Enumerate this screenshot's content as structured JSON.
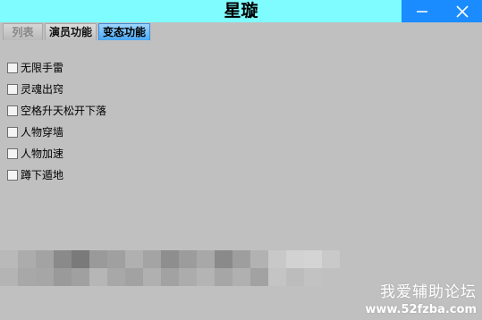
{
  "window": {
    "title": "星璇",
    "minimize_icon": "minimize-icon",
    "close_icon": "close-icon",
    "titlebar_color": "#7ffcff",
    "button_color": "#1a8cff"
  },
  "tabs": [
    {
      "label": "列表",
      "state": "disabled"
    },
    {
      "label": "演员功能",
      "state": "normal"
    },
    {
      "label": "变态功能",
      "state": "selected"
    }
  ],
  "options": [
    {
      "label": "无限手雷",
      "checked": false
    },
    {
      "label": "灵魂出窍",
      "checked": false
    },
    {
      "label": "空格升天松开下落",
      "checked": false
    },
    {
      "label": "人物穿墙",
      "checked": false
    },
    {
      "label": "人物加速",
      "checked": false
    },
    {
      "label": "蹲下遁地",
      "checked": false
    }
  ],
  "watermark": {
    "line1": "我爱辅助论坛",
    "line2": "www.52fzba.com"
  }
}
